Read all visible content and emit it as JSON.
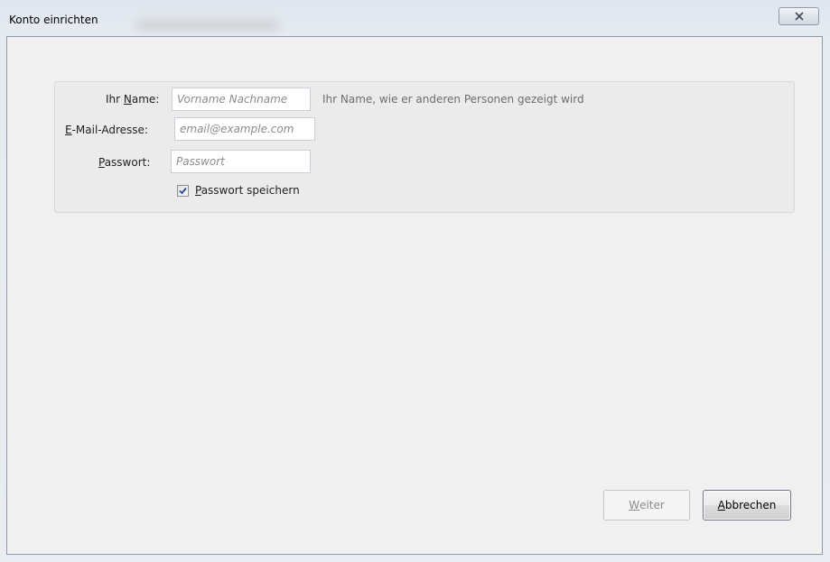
{
  "window": {
    "title": "Konto einrichten"
  },
  "form": {
    "name_label_prefix": "Ihr ",
    "name_label_key": "N",
    "name_label_rest": "ame:",
    "name_placeholder": "Vorname Nachname",
    "name_value": "",
    "name_hint": "Ihr Name, wie er anderen Personen gezeigt wird",
    "email_label_key": "E",
    "email_label_rest": "-Mail-Adresse:",
    "email_placeholder": "email@example.com",
    "email_value": "",
    "password_label_key": "P",
    "password_label_rest": "asswort:",
    "password_placeholder": "Passwort",
    "password_value": "",
    "remember_label_key": "P",
    "remember_label_rest": "asswort speichern",
    "remember_checked": true
  },
  "buttons": {
    "next_key": "W",
    "next_rest": "eiter",
    "next_enabled": false,
    "cancel_key": "A",
    "cancel_rest": "bbrechen"
  },
  "icons": {
    "close": "close-icon",
    "check": "check-icon"
  },
  "colors": {
    "checkmark": "#2c4a9b",
    "disabled_text": "#8c8c8c",
    "hint_text": "#6d6d6d"
  }
}
